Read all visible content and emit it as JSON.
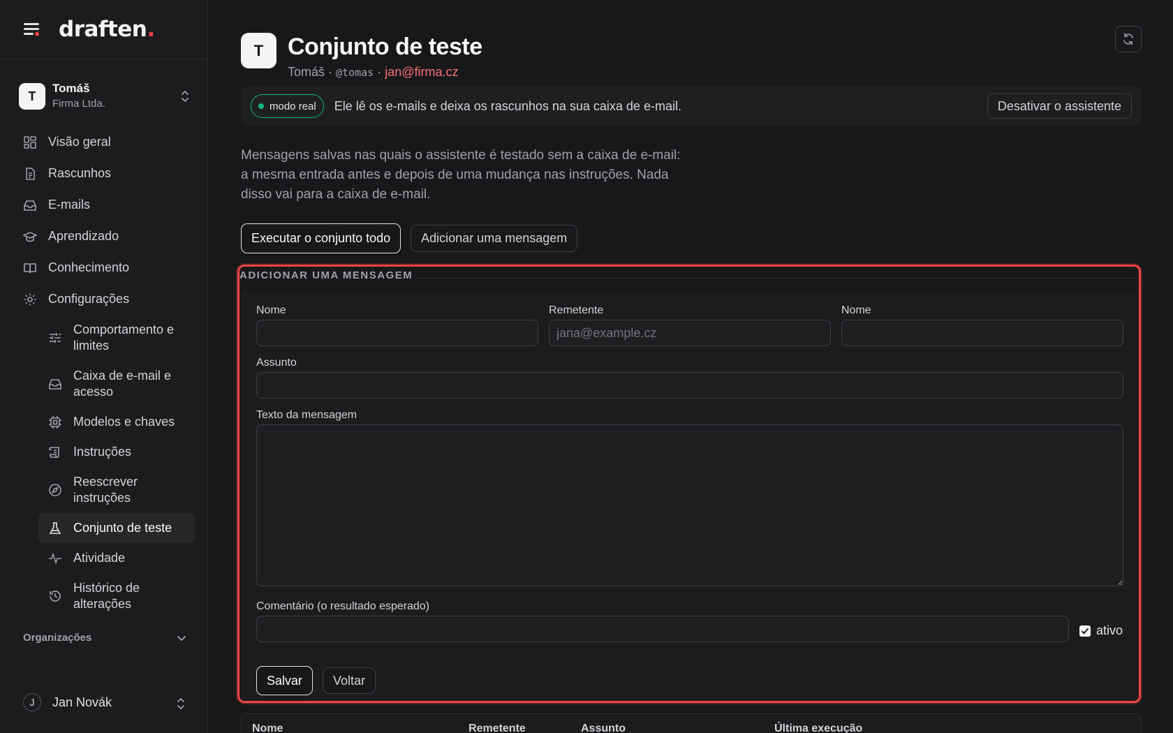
{
  "app": {
    "logo_text": "draften",
    "logo_dot": "."
  },
  "account": {
    "avatar": "T",
    "name": "Tomáš",
    "org": "Firma Ltda."
  },
  "nav": {
    "items": [
      {
        "label": "Visão geral",
        "icon": "dashboard-icon"
      },
      {
        "label": "Rascunhos",
        "icon": "document-icon"
      },
      {
        "label": "E-mails",
        "icon": "inbox-icon"
      },
      {
        "label": "Aprendizado",
        "icon": "graduation-cap-icon"
      },
      {
        "label": "Conhecimento",
        "icon": "book-icon"
      },
      {
        "label": "Configurações",
        "icon": "gear-icon"
      }
    ],
    "sub_items": [
      {
        "label": "Comportamento e limites",
        "icon": "sliders-icon"
      },
      {
        "label": "Caixa de e-mail e acesso",
        "icon": "inbox-icon"
      },
      {
        "label": "Modelos e chaves",
        "icon": "chip-icon"
      },
      {
        "label": "Instruções",
        "icon": "scroll-icon"
      },
      {
        "label": "Reescrever instruções",
        "icon": "compass-icon"
      },
      {
        "label": "Conjunto de teste",
        "icon": "flask-icon",
        "active": true
      },
      {
        "label": "Atividade",
        "icon": "activity-icon"
      },
      {
        "label": "Histórico de alterações",
        "icon": "history-icon"
      }
    ],
    "organizations_label": "Organizações"
  },
  "user": {
    "avatar": "J",
    "name": "Jan Novák"
  },
  "header": {
    "avatar": "T",
    "title": "Conjunto de teste",
    "name": "Tomáš",
    "sep1": " · ",
    "handle": "@tomas",
    "sep2": " · ",
    "email": "jan@firma.cz"
  },
  "live_bar": {
    "badge": "modo real",
    "text": "Ele lê os e-mails e deixa os rascunhos na sua caixa de e-mail.",
    "deactivate_label": "Desativar o assistente"
  },
  "intro": "Mensagens salvas nas quais o assistente é testado sem a caixa de e-mail: a mesma entrada antes e depois de uma mudança nas instruções. Nada disso vai para a caixa de e-mail.",
  "actions": {
    "run_all": "Executar o conjunto todo",
    "add_message": "Adicionar uma mensagem"
  },
  "form": {
    "legend": "ADICIONAR UMA MENSAGEM",
    "name_label": "Nome",
    "sender_label": "Remetente",
    "sender_placeholder": "jana@example.cz",
    "sender_name_label": "Nome",
    "subject_label": "Assunto",
    "body_label": "Texto da mensagem",
    "comment_label": "Comentário (o resultado esperado)",
    "active_label": "ativo",
    "active_checked": true,
    "save_label": "Salvar",
    "back_label": "Voltar"
  },
  "table": {
    "columns": [
      "Nome",
      "Remetente",
      "Assunto",
      "Última execução"
    ]
  },
  "colors": {
    "accent_red": "#ef4444",
    "live_green": "#10b981",
    "email_link": "#f87171"
  }
}
